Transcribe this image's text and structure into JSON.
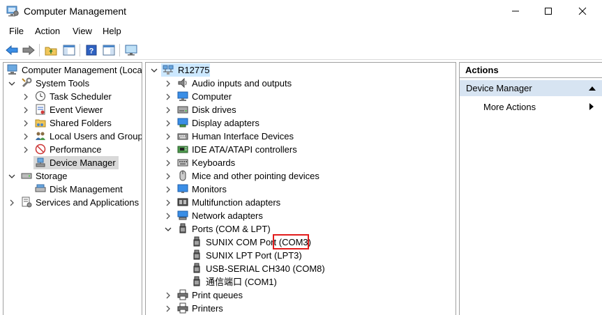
{
  "window": {
    "title": "Computer Management"
  },
  "menu": [
    "File",
    "Action",
    "View",
    "Help"
  ],
  "toolbar_icons": [
    "back-arrow-icon",
    "forward-arrow-icon",
    "up-folder-icon",
    "show-hide-tree-icon",
    "help-icon",
    "properties-icon",
    "monitor-icon"
  ],
  "left_tree": {
    "root": "Computer Management (Local",
    "system_tools": "System Tools",
    "system_tools_children": [
      "Task Scheduler",
      "Event Viewer",
      "Shared Folders",
      "Local Users and Groups",
      "Performance",
      "Device Manager"
    ],
    "storage": "Storage",
    "storage_children": [
      "Disk Management"
    ],
    "services": "Services and Applications"
  },
  "device_tree": {
    "root": "R12775",
    "categories_before": [
      "Audio inputs and outputs",
      "Computer",
      "Disk drives",
      "Display adapters",
      "Human Interface Devices",
      "IDE ATA/ATAPI controllers",
      "Keyboards",
      "Mice and other pointing devices",
      "Monitors",
      "Multifunction adapters",
      "Network adapters"
    ],
    "ports": "Ports (COM & LPT)",
    "ports_children": [
      "SUNIX COM Port (COM3)",
      "SUNIX LPT Port (LPT3)",
      "USB-SERIAL CH340 (COM8)",
      "通信端口 (COM1)"
    ],
    "categories_after": [
      "Print queues",
      "Printers"
    ]
  },
  "actions": {
    "header": "Actions",
    "section": "Device Manager",
    "more": "More Actions"
  },
  "colors": {
    "selection_gray": "#d9d9d9",
    "actions_section_bg": "#d7e4f2",
    "highlight_red": "#e21b1b"
  }
}
